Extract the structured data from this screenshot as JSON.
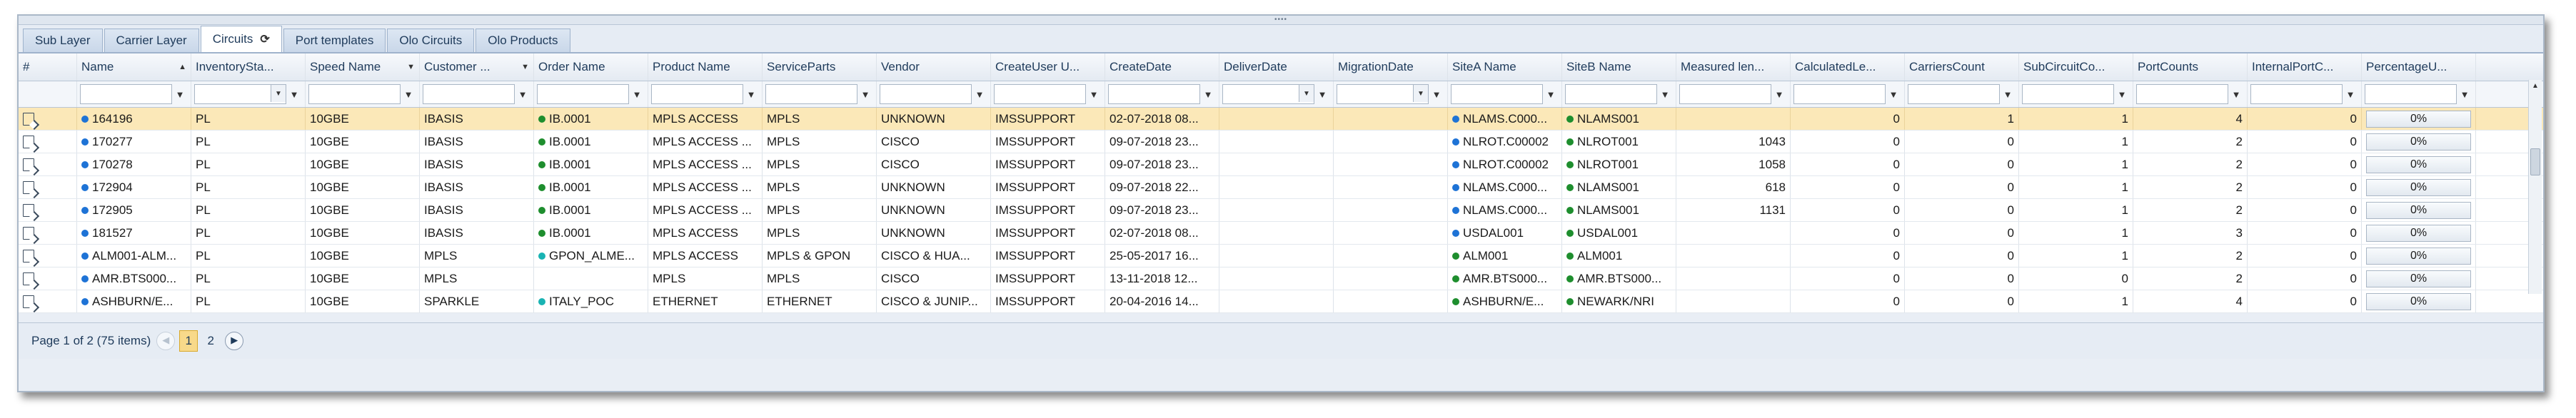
{
  "tabs": [
    {
      "label": "Sub Layer"
    },
    {
      "label": "Carrier Layer"
    },
    {
      "label": "Circuits"
    },
    {
      "label": "Port templates"
    },
    {
      "label": "Olo Circuits"
    },
    {
      "label": "Olo Products"
    }
  ],
  "columns": [
    {
      "label": "#"
    },
    {
      "label": "Name"
    },
    {
      "label": "InventorySta..."
    },
    {
      "label": "Speed Name"
    },
    {
      "label": "Customer ..."
    },
    {
      "label": "Order Name"
    },
    {
      "label": "Product Name"
    },
    {
      "label": "ServiceParts"
    },
    {
      "label": "Vendor"
    },
    {
      "label": "CreateUser U..."
    },
    {
      "label": "CreateDate"
    },
    {
      "label": "DeliverDate"
    },
    {
      "label": "MigrationDate"
    },
    {
      "label": "SiteA Name"
    },
    {
      "label": "SiteB Name"
    },
    {
      "label": "Measured len..."
    },
    {
      "label": "CalculatedLe..."
    },
    {
      "label": "CarriersCount"
    },
    {
      "label": "SubCircuitCo..."
    },
    {
      "label": "PortCounts"
    },
    {
      "label": "InternalPortC..."
    },
    {
      "label": "PercentageU..."
    }
  ],
  "rows": [
    {
      "name": "164196",
      "name_dot": "blue",
      "inv": "PL",
      "speed": "10GBE",
      "customer": "IBASIS",
      "order": "IB.0001",
      "order_dot": "green",
      "product": "MPLS ACCESS",
      "service": "MPLS",
      "vendor": "UNKNOWN",
      "user": "IMSSUPPORT",
      "created": "02-07-2018 08...",
      "deliver": "",
      "migration": "",
      "siteA": "NLAMS.C000...",
      "siteA_dot": "blue",
      "siteB": "NLAMS001",
      "siteB_dot": "green",
      "measured": "",
      "calculated": "0",
      "carriers": "1",
      "subcircuits": "1",
      "ports": "4",
      "internal": "0",
      "pct": "0%"
    },
    {
      "name": "170277",
      "name_dot": "blue",
      "inv": "PL",
      "speed": "10GBE",
      "customer": "IBASIS",
      "order": "IB.0001",
      "order_dot": "green",
      "product": "MPLS ACCESS ...",
      "service": "MPLS",
      "vendor": "CISCO",
      "user": "IMSSUPPORT",
      "created": "09-07-2018 23...",
      "deliver": "",
      "migration": "",
      "siteA": "NLROT.C00002",
      "siteA_dot": "blue",
      "siteB": "NLROT001",
      "siteB_dot": "green",
      "measured": "1043",
      "calculated": "0",
      "carriers": "0",
      "subcircuits": "1",
      "ports": "2",
      "internal": "0",
      "pct": "0%"
    },
    {
      "name": "170278",
      "name_dot": "blue",
      "inv": "PL",
      "speed": "10GBE",
      "customer": "IBASIS",
      "order": "IB.0001",
      "order_dot": "green",
      "product": "MPLS ACCESS ...",
      "service": "MPLS",
      "vendor": "CISCO",
      "user": "IMSSUPPORT",
      "created": "09-07-2018 23...",
      "deliver": "",
      "migration": "",
      "siteA": "NLROT.C00002",
      "siteA_dot": "blue",
      "siteB": "NLROT001",
      "siteB_dot": "green",
      "measured": "1058",
      "calculated": "0",
      "carriers": "0",
      "subcircuits": "1",
      "ports": "2",
      "internal": "0",
      "pct": "0%"
    },
    {
      "name": "172904",
      "name_dot": "blue",
      "inv": "PL",
      "speed": "10GBE",
      "customer": "IBASIS",
      "order": "IB.0001",
      "order_dot": "green",
      "product": "MPLS ACCESS ...",
      "service": "MPLS",
      "vendor": "UNKNOWN",
      "user": "IMSSUPPORT",
      "created": "09-07-2018 22...",
      "deliver": "",
      "migration": "",
      "siteA": "NLAMS.C000...",
      "siteA_dot": "blue",
      "siteB": "NLAMS001",
      "siteB_dot": "green",
      "measured": "618",
      "calculated": "0",
      "carriers": "0",
      "subcircuits": "1",
      "ports": "2",
      "internal": "0",
      "pct": "0%"
    },
    {
      "name": "172905",
      "name_dot": "blue",
      "inv": "PL",
      "speed": "10GBE",
      "customer": "IBASIS",
      "order": "IB.0001",
      "order_dot": "green",
      "product": "MPLS ACCESS ...",
      "service": "MPLS",
      "vendor": "UNKNOWN",
      "user": "IMSSUPPORT",
      "created": "09-07-2018 23...",
      "deliver": "",
      "migration": "",
      "siteA": "NLAMS.C000...",
      "siteA_dot": "blue",
      "siteB": "NLAMS001",
      "siteB_dot": "green",
      "measured": "1131",
      "calculated": "0",
      "carriers": "0",
      "subcircuits": "1",
      "ports": "2",
      "internal": "0",
      "pct": "0%"
    },
    {
      "name": "181527",
      "name_dot": "blue",
      "inv": "PL",
      "speed": "10GBE",
      "customer": "IBASIS",
      "order": "IB.0001",
      "order_dot": "green",
      "product": "MPLS ACCESS",
      "service": "MPLS",
      "vendor": "UNKNOWN",
      "user": "IMSSUPPORT",
      "created": "02-07-2018 08...",
      "deliver": "",
      "migration": "",
      "siteA": "USDAL001",
      "siteA_dot": "blue",
      "siteB": "USDAL001",
      "siteB_dot": "green",
      "measured": "",
      "calculated": "0",
      "carriers": "0",
      "subcircuits": "1",
      "ports": "3",
      "internal": "0",
      "pct": "0%"
    },
    {
      "name": "ALM001-ALM...",
      "name_dot": "blue",
      "inv": "PL",
      "speed": "10GBE",
      "customer": "MPLS",
      "order": "GPON_ALME...",
      "order_dot": "teal",
      "product": "MPLS ACCESS",
      "service": "MPLS & GPON",
      "vendor": "CISCO & HUA...",
      "user": "IMSSUPPORT",
      "created": "25-05-2017 16...",
      "deliver": "",
      "migration": "",
      "siteA": "ALM001",
      "siteA_dot": "green",
      "siteB": "ALM001",
      "siteB_dot": "green",
      "measured": "",
      "calculated": "0",
      "carriers": "0",
      "subcircuits": "1",
      "ports": "2",
      "internal": "0",
      "pct": "0%"
    },
    {
      "name": "AMR.BTS000...",
      "name_dot": "blue",
      "inv": "PL",
      "speed": "10GBE",
      "customer": "MPLS",
      "order": "",
      "order_dot": "",
      "product": "MPLS",
      "service": "MPLS",
      "vendor": "CISCO",
      "user": "IMSSUPPORT",
      "created": "13-11-2018 12...",
      "deliver": "",
      "migration": "",
      "siteA": "AMR.BTS000...",
      "siteA_dot": "green",
      "siteB": "AMR.BTS000...",
      "siteB_dot": "green",
      "measured": "",
      "calculated": "0",
      "carriers": "0",
      "subcircuits": "0",
      "ports": "2",
      "internal": "0",
      "pct": "0%"
    },
    {
      "name": "ASHBURN/E...",
      "name_dot": "blue",
      "inv": "PL",
      "speed": "10GBE",
      "customer": "SPARKLE",
      "order": "ITALY_POC",
      "order_dot": "teal",
      "product": "ETHERNET",
      "service": "ETHERNET",
      "vendor": "CISCO & JUNIP...",
      "user": "IMSSUPPORT",
      "created": "20-04-2016 14...",
      "deliver": "",
      "migration": "",
      "siteA": "ASHBURN/E...",
      "siteA_dot": "green",
      "siteB": "NEWARK/NRI",
      "siteB_dot": "green",
      "measured": "",
      "calculated": "0",
      "carriers": "0",
      "subcircuits": "1",
      "ports": "4",
      "internal": "0",
      "pct": "0%"
    }
  ],
  "pager": {
    "summary": "Page 1 of 2 (75 items)",
    "pages": [
      "1",
      "2"
    ],
    "current": "1"
  }
}
